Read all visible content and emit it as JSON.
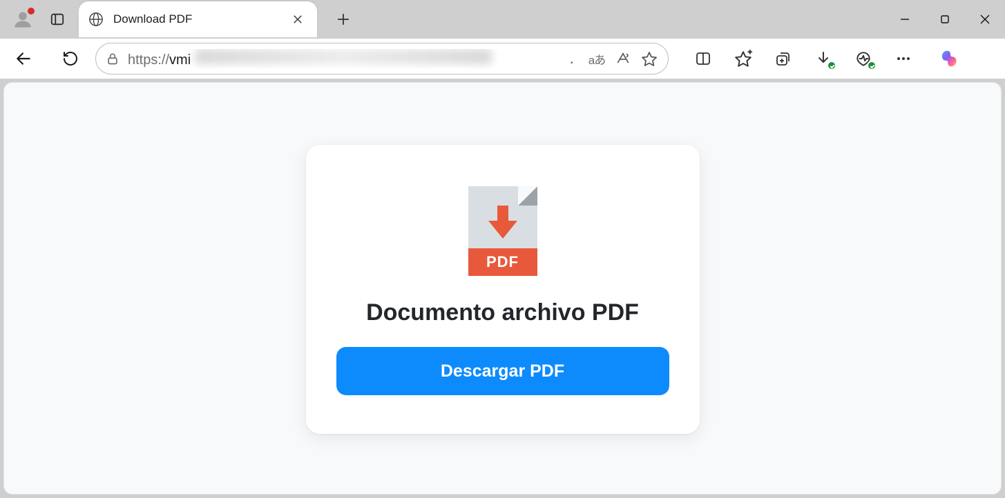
{
  "browser": {
    "tab_title": "Download PDF",
    "url_scheme": "https://",
    "url_host_visible": "vmi",
    "toolbar_icons": {
      "translate": "aあ"
    }
  },
  "page": {
    "pdf_badge": "PDF",
    "heading": "Documento archivo PDF",
    "download_button": "Descargar PDF"
  }
}
